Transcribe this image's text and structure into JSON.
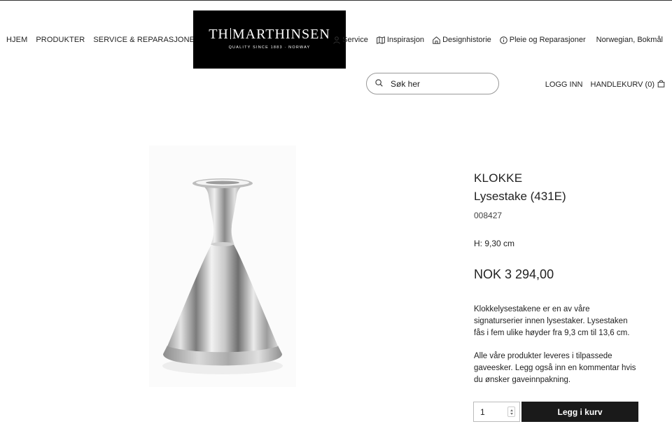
{
  "nav": {
    "items": [
      {
        "label": "HJEM"
      },
      {
        "label": "PRODUKTER"
      },
      {
        "label": "SERVICE & REPARASJONER"
      }
    ]
  },
  "logo": {
    "left": "TH",
    "right": "MARTHINSEN",
    "tagline": "QUALITY SINCE 1883 · NORWAY"
  },
  "util_nav": {
    "items": [
      {
        "label": "Service",
        "icon": "person-icon"
      },
      {
        "label": "Inspirasjon",
        "icon": "map-icon"
      },
      {
        "label": "Designhistorie",
        "icon": "home-icon"
      },
      {
        "label": "Pleie og Reparasjoner",
        "icon": "info-icon"
      }
    ],
    "language": "Norwegian, Bokmål"
  },
  "search": {
    "placeholder": "Søk her"
  },
  "account": {
    "login": "LOGG INN",
    "cart": "HANDLEKURV (0)"
  },
  "product": {
    "brand": "KLOKKE",
    "name": "Lysestake (431E)",
    "sku": "008427",
    "height": "H: 9,30 cm",
    "price": "NOK 3 294,00",
    "description": [
      "Klokkelysestakene er en av våre signaturserier innen lysestaker. Lysestaken fås i fem ulike høyder fra 9,3 cm til 13,6 cm.",
      "Alle våre produkter leveres i tilpassede gaveesker. Legg også inn en kommentar hvis du ønsker gaveinnpakning."
    ],
    "quantity": "1",
    "add_to_cart": "Legg i kurv"
  }
}
